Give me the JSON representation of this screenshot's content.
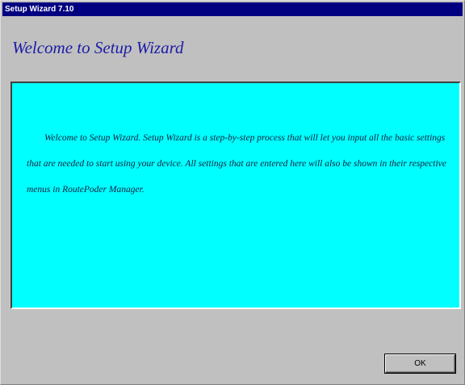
{
  "window": {
    "title": "Setup Wizard 7.10"
  },
  "header": {
    "heading": "Welcome to Setup Wizard"
  },
  "content": {
    "body": "Welcome to Setup Wizard. Setup Wizard is a step-by-step process that will let you input all the basic settings that are needed to start using your device. All settings that are entered here will also be shown in their respective menus in RoutePoder Manager."
  },
  "buttons": {
    "ok_label": "OK"
  },
  "colors": {
    "titlebar": "#000080",
    "panel_background": "#00ffff",
    "heading_text": "#1c1ca8",
    "window_background": "#c0c0c0"
  }
}
